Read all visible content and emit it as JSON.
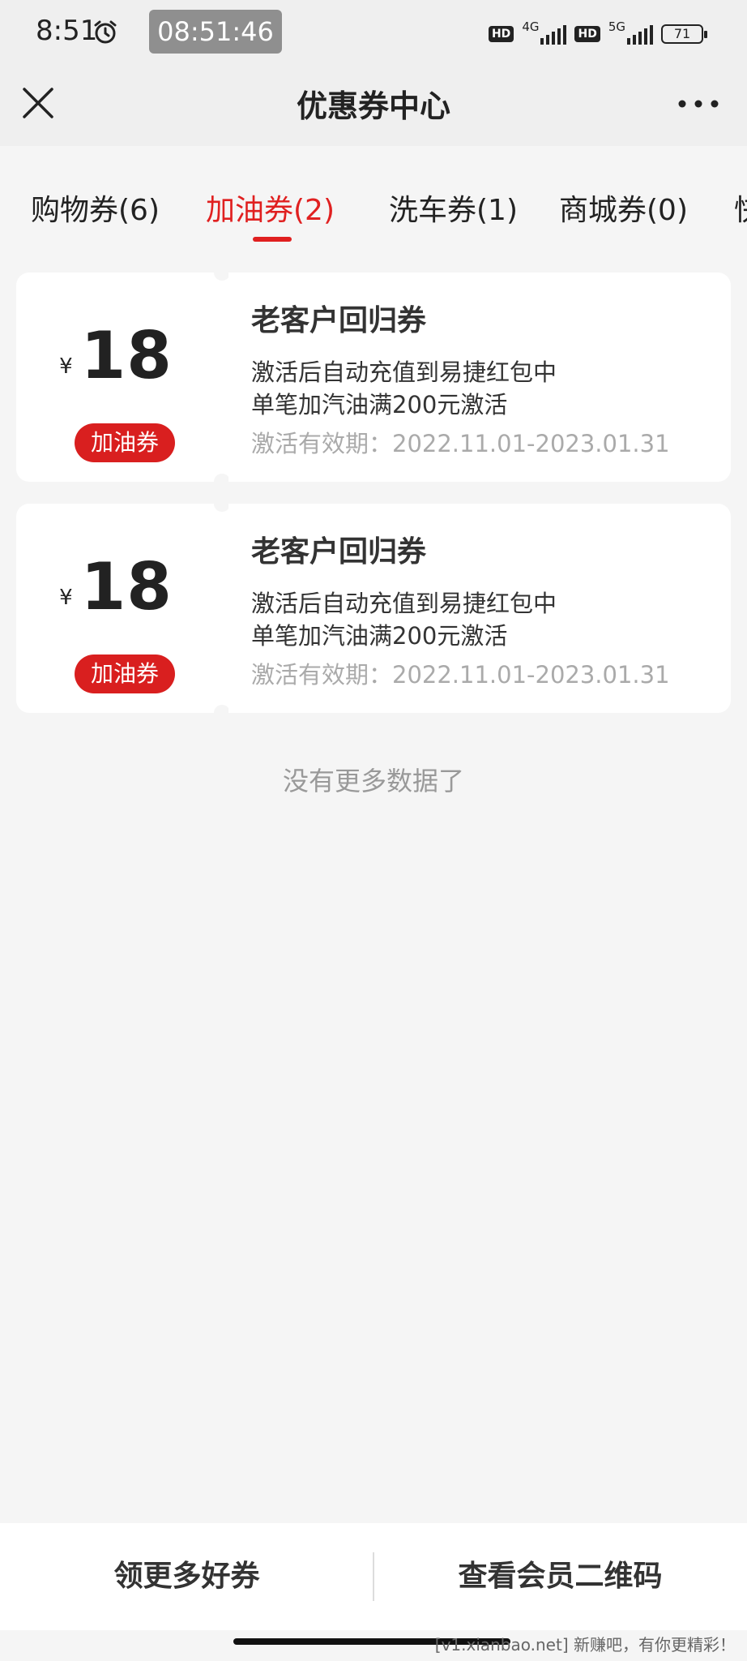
{
  "status_bar": {
    "time": "8:51",
    "clock": "08:51:46",
    "net1": "4G",
    "net2": "5G",
    "hd": "HD",
    "battery": "71"
  },
  "header": {
    "title": "优惠券中心"
  },
  "tabs": [
    {
      "label": "购物券(6)"
    },
    {
      "label": "加油券(2)"
    },
    {
      "label": "洗车券(1)"
    },
    {
      "label": "商城券(0)"
    },
    {
      "label": "快"
    }
  ],
  "coupons": [
    {
      "currency": "¥",
      "amount": "18",
      "tag": "加油券",
      "title": "老客户回归券",
      "desc_line1": "激活后自动充值到易捷红包中",
      "desc_line2": "单笔加汽油满200元激活",
      "validity": "激活有效期：2022.11.01-2023.01.31"
    },
    {
      "currency": "¥",
      "amount": "18",
      "tag": "加油券",
      "title": "老客户回归券",
      "desc_line1": "激活后自动充值到易捷红包中",
      "desc_line2": "单笔加汽油满200元激活",
      "validity": "激活有效期：2022.11.01-2023.01.31"
    }
  ],
  "no_more_text": "没有更多数据了",
  "bottom": {
    "left_label": "领更多好券",
    "right_label": "查看会员二维码"
  },
  "watermark": "[v1.xianbao.net] 新赚吧，有你更精彩！",
  "colors": {
    "accent": "#e02020",
    "tag_bg": "#d91f1f"
  }
}
